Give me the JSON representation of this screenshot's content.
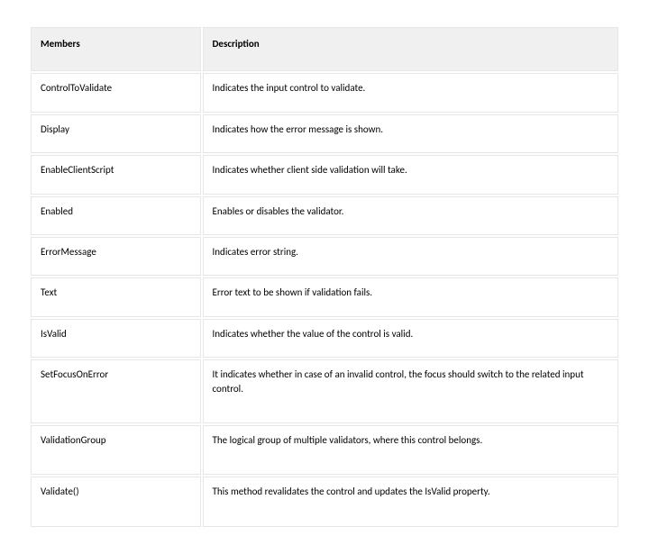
{
  "table": {
    "headers": {
      "members": "Members",
      "description": "Description"
    },
    "rows": [
      {
        "member": "ControlToValidate",
        "desc": "Indicates the input control to validate."
      },
      {
        "member": "Display",
        "desc": "Indicates how the error message is shown."
      },
      {
        "member": "EnableClientScript",
        "desc": "Indicates whether client side validation will take."
      },
      {
        "member": "Enabled",
        "desc": "Enables or disables the validator."
      },
      {
        "member": "ErrorMessage",
        "desc": "Indicates error string."
      },
      {
        "member": "Text",
        "desc": "Error text to be shown if validation fails."
      },
      {
        "member": "IsValid",
        "desc": "Indicates whether the value of the control is valid."
      },
      {
        "member": "SetFocusOnError",
        "desc": "It indicates whether in case of an invalid control, the focus should switch to the related input control."
      },
      {
        "member": "ValidationGroup",
        "desc": "The logical group of multiple validators, where this control belongs."
      },
      {
        "member": "Validate()",
        "desc": "This method revalidates the control and updates the IsValid property."
      }
    ]
  }
}
